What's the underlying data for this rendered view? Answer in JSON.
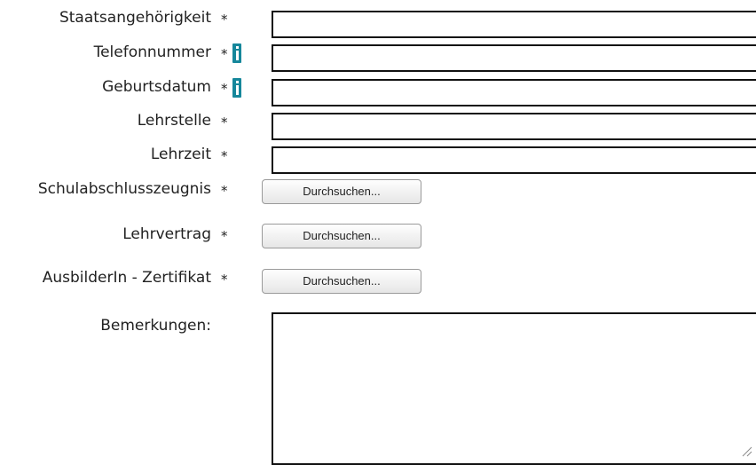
{
  "form": {
    "required_marker": "*",
    "fields": [
      {
        "label": "Staatsangehörigkeit",
        "value": ""
      },
      {
        "label": "Telefonnummer",
        "value": ""
      },
      {
        "label": "Geburtsdatum",
        "value": ""
      },
      {
        "label": "Lehrstelle",
        "value": ""
      },
      {
        "label": "Lehrzeit",
        "value": ""
      }
    ],
    "uploads": [
      {
        "label": "Schulabschlusszeugnis",
        "button_label": "Durchsuchen..."
      },
      {
        "label": "Lehrvertrag",
        "button_label": "Durchsuchen..."
      },
      {
        "label": "AusbilderIn - Zertifikat",
        "button_label": "Durchsuchen..."
      }
    ],
    "remarks": {
      "label": "Bemerkungen:",
      "value": ""
    }
  },
  "icons": {
    "info": "info-icon",
    "info_color": "#16879b",
    "resize": "resize-grip-icon"
  }
}
